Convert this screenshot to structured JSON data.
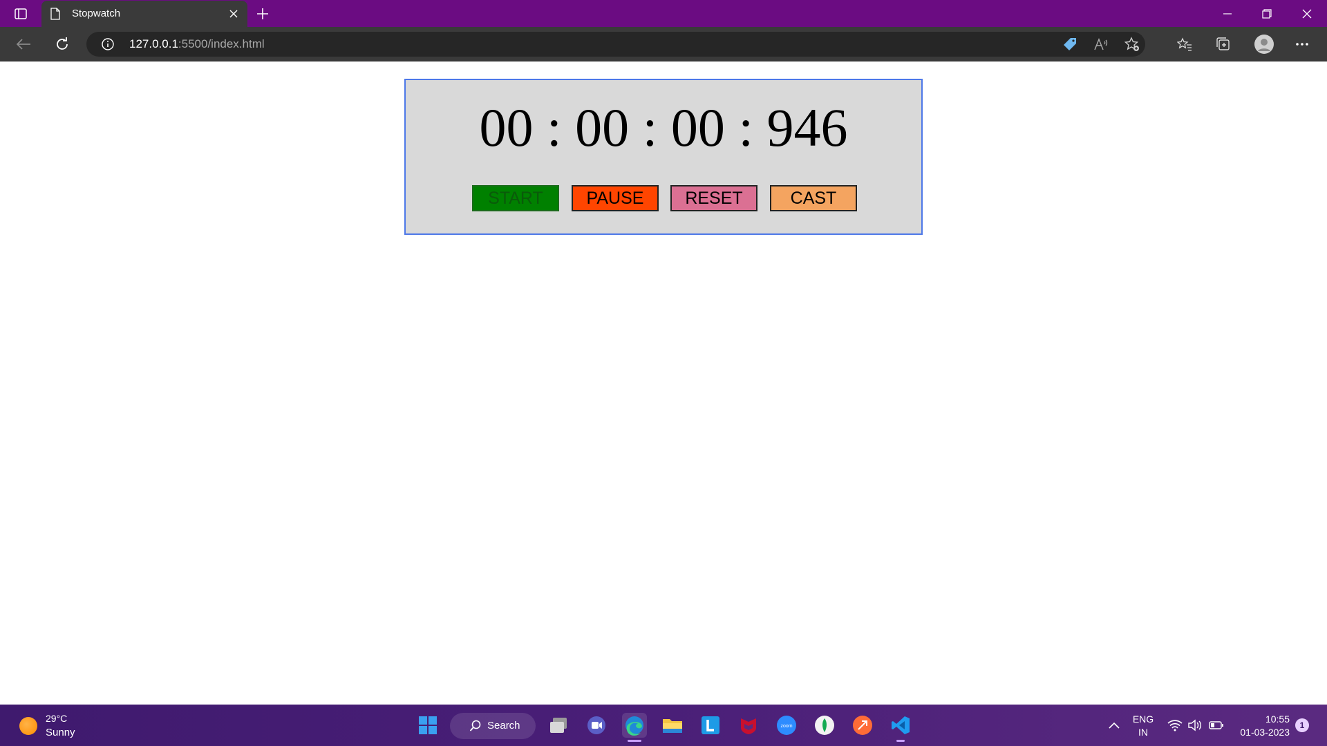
{
  "browser": {
    "tab_title": "Stopwatch",
    "url_host": "127.0.0.1",
    "url_path": ":5500/index.html"
  },
  "stopwatch": {
    "time": "00 : 00 : 00 : 946",
    "buttons": {
      "start": "START",
      "pause": "PAUSE",
      "reset": "RESET",
      "cast": "CAST"
    },
    "colors": {
      "panel": "#d9d9d9",
      "border": "#4d78e8",
      "start": "#008000",
      "pause": "#ff4500",
      "reset": "#db7093",
      "cast": "#f4a460"
    }
  },
  "taskbar": {
    "weather_temp": "29°C",
    "weather_condition": "Sunny",
    "search_label": "Search",
    "lang_line1": "ENG",
    "lang_line2": "IN",
    "time": "10:55",
    "date": "01-03-2023",
    "notification_count": "1",
    "apps": [
      "windows-start",
      "search",
      "task-view",
      "teams-meet",
      "edge",
      "file-explorer",
      "l-app",
      "mcafee",
      "zoom",
      "mongodb-compass",
      "postman",
      "vscode"
    ]
  }
}
